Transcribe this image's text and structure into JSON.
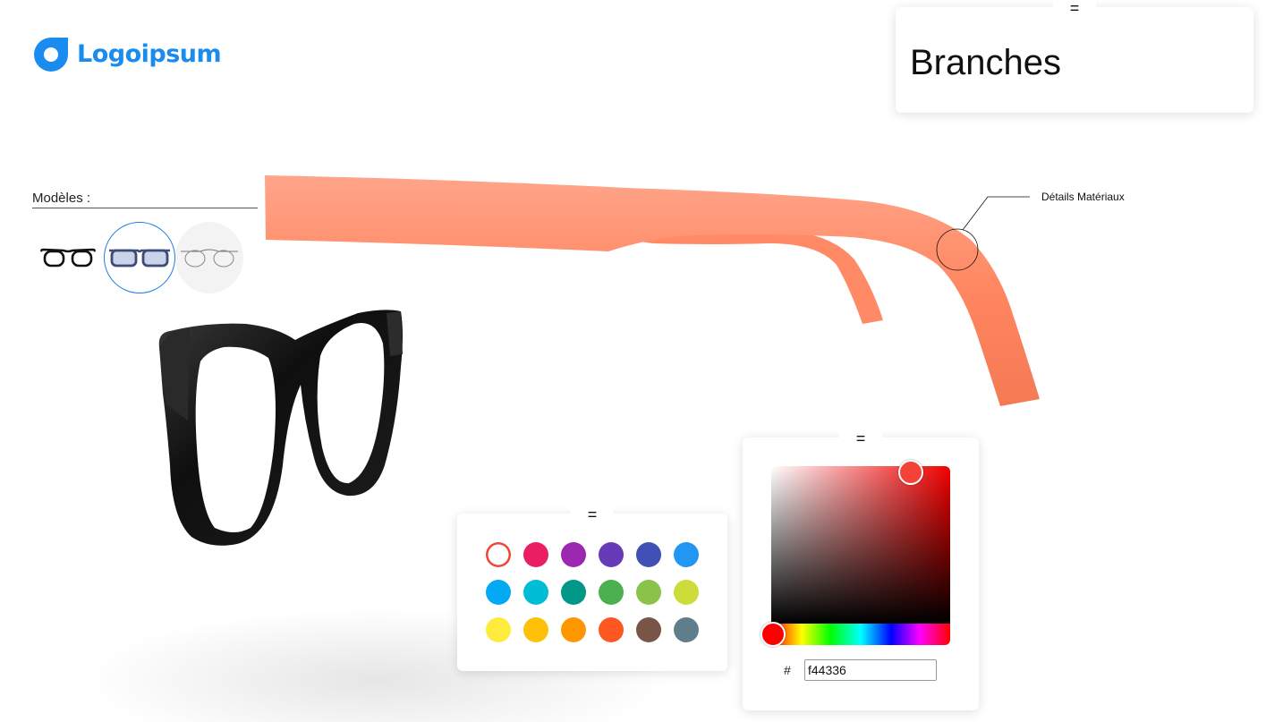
{
  "brand": {
    "name": "Logoipsum",
    "color": "#1a8cf0"
  },
  "models": {
    "label": "Modèles :",
    "items": [
      {
        "name": "Black acetate frame",
        "selected": false
      },
      {
        "name": "Navy rectangle frame",
        "selected": true
      },
      {
        "name": "Thin metal frame",
        "selected": false
      }
    ]
  },
  "scene": {
    "callout_label": "Détails Matériaux",
    "branch_color": "#ff8a65",
    "frame_color": "#111111"
  },
  "branches_panel": {
    "handle": "=",
    "title": "Branches"
  },
  "swatch_panel": {
    "handle": "=",
    "selected_index": 0,
    "colors": [
      "#f44336",
      "#e91e63",
      "#9c27b0",
      "#673ab7",
      "#3f51b5",
      "#2196f3",
      "#03a9f4",
      "#00bcd4",
      "#009688",
      "#4caf50",
      "#8bc34a",
      "#cddc39",
      "#ffeb3b",
      "#ffc107",
      "#ff9800",
      "#ff5722",
      "#795548",
      "#607d8b"
    ]
  },
  "picker_panel": {
    "handle": "=",
    "hash": "#",
    "hex_value": "f44336"
  }
}
